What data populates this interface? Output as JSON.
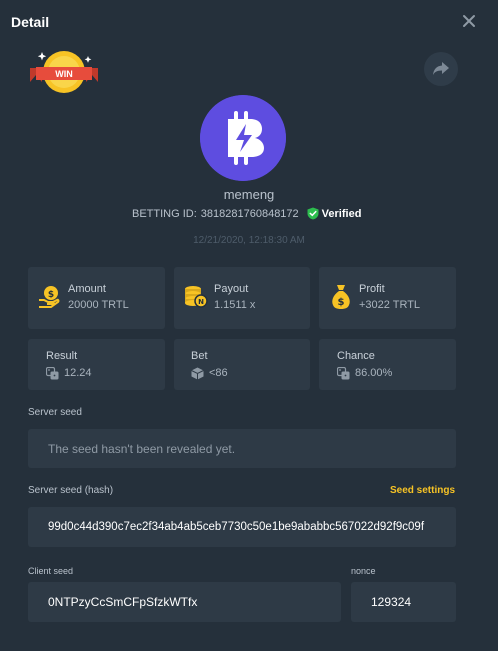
{
  "header": {
    "title": "Detail"
  },
  "badge": {
    "label": "WIN"
  },
  "user": {
    "name": "memeng",
    "betting_id_label": "BETTING ID:",
    "betting_id": "3818281760848172",
    "verified_label": "Verified"
  },
  "timestamp": "12/21/2020, 12:18:30 AM",
  "stats": {
    "amount": {
      "label": "Amount",
      "value": "20000 TRTL"
    },
    "payout": {
      "label": "Payout",
      "value": "1.1511 x"
    },
    "profit": {
      "label": "Profit",
      "value": "+3022 TRTL"
    },
    "result": {
      "label": "Result",
      "value": "12.24"
    },
    "bet": {
      "label": "Bet",
      "value": "<86"
    },
    "chance": {
      "label": "Chance",
      "value": "86.00%"
    }
  },
  "server_seed": {
    "label": "Server seed",
    "value": "The seed hasn't been revealed yet."
  },
  "server_seed_hash": {
    "label": "Server seed (hash)",
    "settings_label": "Seed settings",
    "value": "99d0c44d390c7ec2f34ab4ab5ceb7730c50e1be9ababbc567022d92f9c09f"
  },
  "client_seed": {
    "label": "Client seed",
    "value": "0NTPzyCcSmCFpSfzkWTfx"
  },
  "nonce": {
    "label": "nonce",
    "value": "129324"
  },
  "colors": {
    "background": "#25303b",
    "card": "#2e3a46",
    "accent_yellow": "#f7c325",
    "avatar": "#5e4de0",
    "verified_green": "#2dbd4e"
  }
}
